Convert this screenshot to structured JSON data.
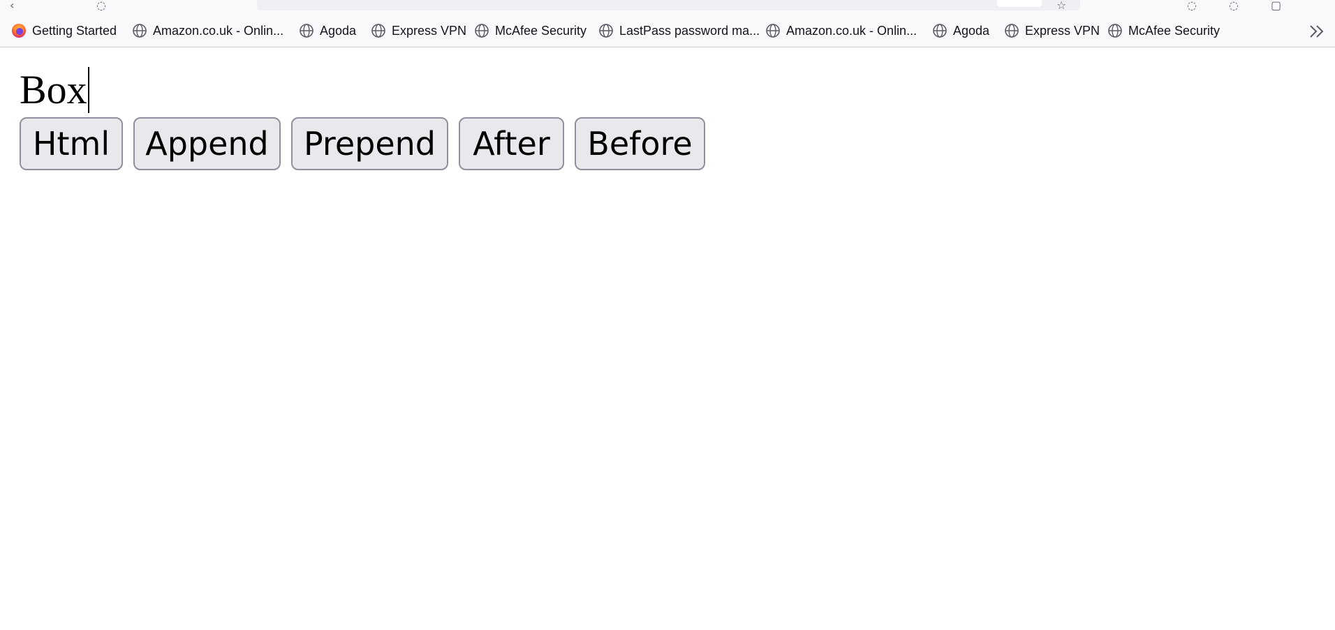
{
  "browser": {
    "bookmarks": [
      {
        "label": "Getting Started",
        "icon": "firefox-logo-icon"
      },
      {
        "label": "Amazon.co.uk - Onlin...",
        "icon": "globe-icon"
      },
      {
        "label": "Agoda",
        "icon": "globe-icon"
      },
      {
        "label": "Express VPN",
        "icon": "globe-icon"
      },
      {
        "label": "McAfee Security",
        "icon": "globe-icon"
      },
      {
        "label": "LastPass password ma...",
        "icon": "globe-icon"
      },
      {
        "label": "Amazon.co.uk - Onlin...",
        "icon": "globe-icon"
      },
      {
        "label": "Agoda",
        "icon": "globe-icon"
      },
      {
        "label": "Express VPN",
        "icon": "globe-icon"
      },
      {
        "label": "McAfee Security",
        "icon": "globe-icon"
      }
    ],
    "overflow_icon": "chevron-double-right-icon"
  },
  "page": {
    "box_text": "Box",
    "buttons": [
      {
        "label": "Html"
      },
      {
        "label": "Append"
      },
      {
        "label": "Prepend"
      },
      {
        "label": "After"
      },
      {
        "label": "Before"
      }
    ]
  },
  "colors": {
    "toolbar_bg": "#f9f9fb",
    "button_bg": "#e9e9ed",
    "button_border": "#8f8f9d",
    "text": "#000000"
  }
}
